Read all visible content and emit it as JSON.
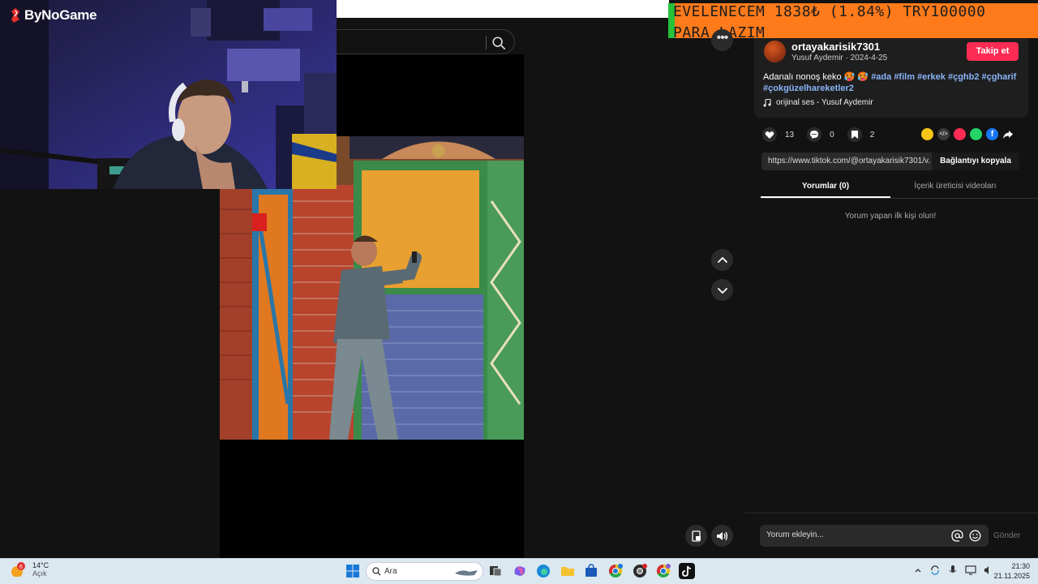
{
  "stream": {
    "logo_text": "ByNoGame",
    "ticker_line1": "EVELENECEM  1838₺ (1.84%)  TRY100000",
    "ticker_line2": "PARA LAZIM",
    "colors": {
      "ticker_bg": "#ff7a1a",
      "ticker_progress": "#27c13a"
    }
  },
  "video_page": {
    "search_icon": "search-icon",
    "more_label": "•••",
    "nav": {
      "up_icon": "chevron-up-icon",
      "down_icon": "chevron-down-icon"
    },
    "controls": {
      "pip_icon": "picture-in-picture-icon",
      "volume_icon": "volume-icon"
    }
  },
  "post": {
    "username": "ortayakarisik7301",
    "author_date": "Yusuf Aydemir · 2024-4-25",
    "follow_label": "Takip et",
    "caption_text": "Adanalı nonoş keko 🥵 🥵 ",
    "hashtags_line1": "#ada #film #erkek #çghb2 #çgharif",
    "hashtags_line2": "#çokgüzelhareketler2",
    "music": "orijinal ses - Yusuf Aydemir",
    "likes": "13",
    "comments": "0",
    "saves": "2",
    "link_url": "https://www.tiktok.com/@ortayakarisik7301/v...",
    "copy_label": "Bağlantıyı kopyala",
    "share_icons": [
      "friends-share-icon",
      "embed-icon",
      "send-icon",
      "whatsapp-icon",
      "facebook-icon",
      "share-arrow-icon"
    ]
  },
  "tabs": [
    {
      "label": "Yorumlar (0)"
    },
    {
      "label": "İçerik üreticisi videoları"
    }
  ],
  "comments": {
    "empty_text": "Yorum yapan ilk kişi olun!",
    "placeholder": "Yorum ekleyin...",
    "send_label": "Gönder"
  },
  "taskbar": {
    "weather_badge": "6",
    "temperature": "14°C",
    "condition": "Açık",
    "search_placeholder": "Ara",
    "time": "21:30",
    "date": "21.11.2025",
    "app_icons": [
      "windows-start-icon",
      "task-view-icon",
      "copilot-icon",
      "edge-icon",
      "file-explorer-icon",
      "store-icon",
      "chrome-icon",
      "chrome-icon-2",
      "chrome-icon-3",
      "tiktok-icon"
    ]
  }
}
